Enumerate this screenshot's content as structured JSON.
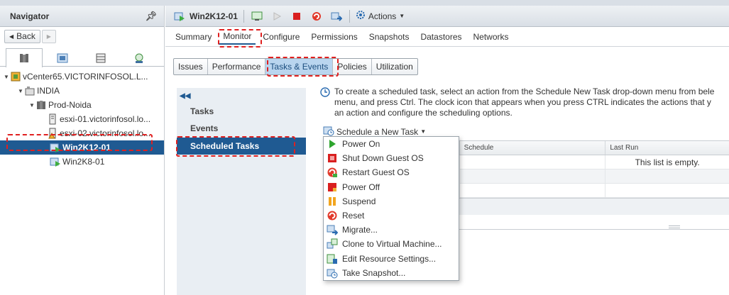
{
  "navigator": {
    "title": "Navigator",
    "back_label": "Back",
    "tree": [
      {
        "label": "vCenter65.VICTORINFOSOL.L...",
        "icon": "vcenter-icon"
      },
      {
        "label": "INDIA",
        "icon": "datacenter-icon"
      },
      {
        "label": "Prod-Noida",
        "icon": "cluster-icon"
      },
      {
        "label": "esxi-01.victorinfosol.lo...",
        "icon": "host-icon"
      },
      {
        "label": "esxi-02.victorinfosol.lo...",
        "icon": "host-warning-icon"
      },
      {
        "label": "Win2K12-01",
        "icon": "vm-running-icon"
      },
      {
        "label": "Win2K8-01",
        "icon": "vm-running-icon"
      }
    ]
  },
  "object": {
    "title": "Win2K12-01",
    "actions_label": "Actions"
  },
  "main_tabs": [
    "Summary",
    "Monitor",
    "Configure",
    "Permissions",
    "Snapshots",
    "Datastores",
    "Networks"
  ],
  "sub_tabs": [
    "Issues",
    "Performance",
    "Tasks & Events",
    "Policies",
    "Utilization"
  ],
  "side_items": [
    "Tasks",
    "Events",
    "Scheduled Tasks"
  ],
  "info": {
    "line1": "To create a scheduled task, select an action from the Schedule New Task drop-down menu from bele",
    "line2": "menu, and press Ctrl. The clock icon that appears when you press CTRL indicates the actions that y",
    "line3": "an action and configure the scheduling options."
  },
  "schedule_button": "Schedule a New Task",
  "table": {
    "columns": [
      "Schedule",
      "Last Run"
    ],
    "empty_text": "This list is empty."
  },
  "menu_items": [
    {
      "label": "Power On",
      "icon": "power-on-icon"
    },
    {
      "label": "Shut Down Guest OS",
      "icon": "shutdown-icon"
    },
    {
      "label": "Restart Guest OS",
      "icon": "restart-icon"
    },
    {
      "label": "Power Off",
      "icon": "power-off-icon"
    },
    {
      "label": "Suspend",
      "icon": "suspend-icon"
    },
    {
      "label": "Reset",
      "icon": "reset-icon"
    },
    {
      "label": "Migrate...",
      "icon": "migrate-icon"
    },
    {
      "label": "Clone to Virtual Machine...",
      "icon": "clone-icon"
    },
    {
      "label": "Edit Resource Settings...",
      "icon": "resource-settings-icon"
    },
    {
      "label": "Take Snapshot...",
      "icon": "snapshot-icon"
    }
  ],
  "colors": {
    "selected": "#1f5a92",
    "highlight_dash": "#e02020",
    "active_subtab": "#b9d5ef"
  }
}
